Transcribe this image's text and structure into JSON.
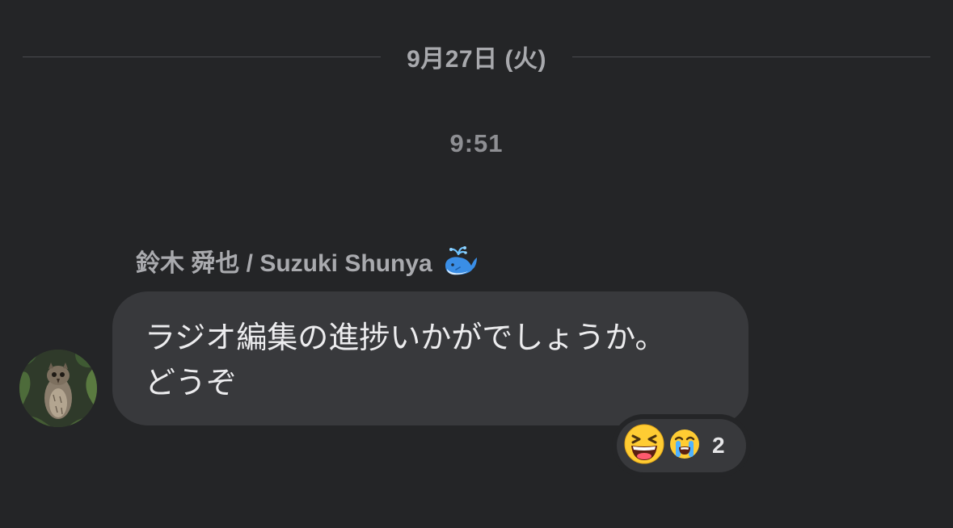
{
  "date_divider": {
    "label": "9月27日 (火)"
  },
  "time_label": "9:51",
  "message": {
    "sender": "鈴木 舜也 / Suzuki Shunya",
    "sender_badge_icon": "spouting-whale-icon",
    "text_lines": [
      "ラジオ編集の進捗いかがでしょうか。",
      "どうぞ"
    ],
    "avatar_icon": "owl-photo-avatar"
  },
  "reactions": {
    "emojis": [
      "laughing-squint-emoji",
      "loudly-crying-emoji"
    ],
    "count": "2"
  },
  "colors": {
    "background": "#242527",
    "bubble": "#38393c",
    "muted_text": "#a8a9ad"
  }
}
